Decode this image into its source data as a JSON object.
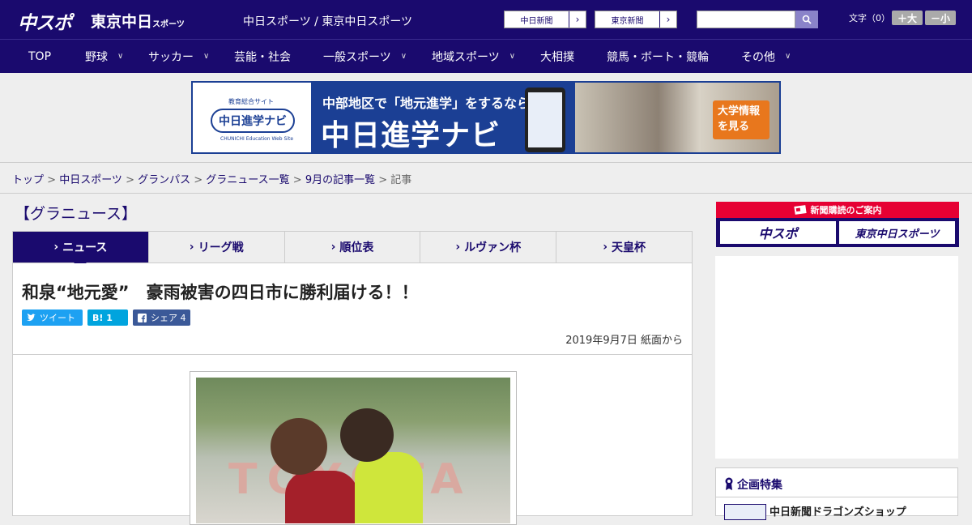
{
  "header": {
    "logo_main": "中スポ",
    "logo_tokyo": "東京中日",
    "logo_tokyo_small": "スポーツ",
    "site_title": "中日スポーツ / 東京中日スポーツ",
    "paper_links": [
      {
        "label": "中日新聞",
        "arrow": "›"
      },
      {
        "label": "東京新聞",
        "arrow": "›"
      }
    ],
    "search_placeholder": "",
    "font_size_label": "文字（0）",
    "font_larger": "＋大",
    "font_smaller": "－小"
  },
  "nav": {
    "items": [
      {
        "label": "TOP",
        "has_menu": false
      },
      {
        "label": "野球",
        "has_menu": true
      },
      {
        "label": "サッカー",
        "has_menu": true
      },
      {
        "label": "芸能・社会",
        "has_menu": false
      },
      {
        "label": "一般スポーツ",
        "has_menu": true
      },
      {
        "label": "地域スポーツ",
        "has_menu": true
      },
      {
        "label": "大相撲",
        "has_menu": false
      },
      {
        "label": "競馬・ボート・競輪",
        "has_menu": false
      },
      {
        "label": "その他",
        "has_menu": true
      }
    ]
  },
  "banner": {
    "left_sub": "教育総合サイト",
    "left_name": "中日進学ナビ",
    "left_en": "CHUNICHI Education Web Site",
    "line1": "中部地区で「地元進学」をするなら",
    "line2": "中日進学ナビ",
    "cta": "大学情報を見る"
  },
  "breadcrumb": {
    "items": [
      "トップ",
      "中日スポーツ",
      "グランパス",
      "グラニュース一覧",
      "9月の記事一覧"
    ],
    "current": "記事",
    "sep": " > "
  },
  "section": {
    "title": "【グラニュース】"
  },
  "tabs": [
    {
      "label": "ニュース",
      "active": true
    },
    {
      "label": "リーグ戦",
      "active": false
    },
    {
      "label": "順位表",
      "active": false
    },
    {
      "label": "ルヴァン杯",
      "active": false
    },
    {
      "label": "天皇杯",
      "active": false
    }
  ],
  "article": {
    "title": "和泉“地元愛”　豪雨被害の四日市に勝利届ける！！",
    "share": {
      "tweet": "ツイート",
      "hatena": "B! 1",
      "facebook": "シェア 4"
    },
    "date": "2019年9月7日 紙面から",
    "photo_text": "TOYOTA"
  },
  "sidebar": {
    "subscribe_head": "新聞購読のご案内",
    "subscribe_logos": [
      "中スポ",
      "東京中日スポーツ"
    ],
    "feature_title": "企画特集",
    "feature_item": "中日新聞ドラゴンズショップ"
  },
  "colors": {
    "brand": "#1a0a6e",
    "accent_red": "#e60033",
    "twitter": "#1da1f2",
    "hatena": "#00a4de",
    "facebook": "#3b5998"
  }
}
